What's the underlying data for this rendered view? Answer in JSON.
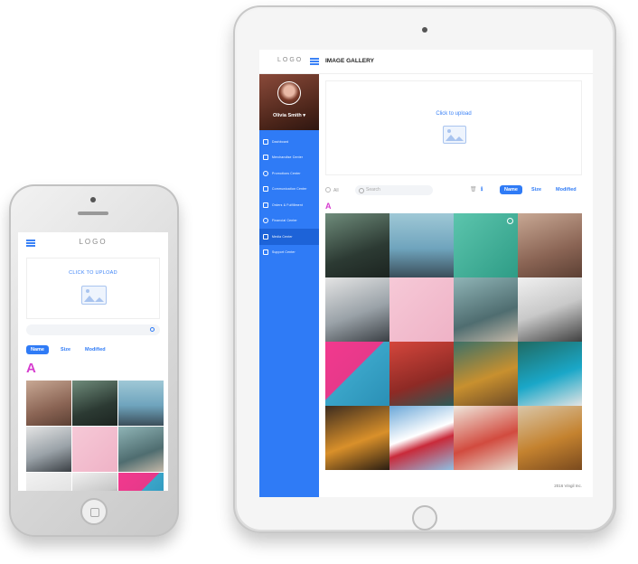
{
  "tablet": {
    "logo": "LOGO",
    "title": "IMAGE GALLERY",
    "user_name": "Olivia Smith",
    "user_caret": "▾",
    "nav": [
      {
        "label": "Dashboard",
        "icon": "grid-icon"
      },
      {
        "label": "Merchandise Center",
        "icon": "list-icon"
      },
      {
        "label": "Promotions Center",
        "icon": "megaphone-icon"
      },
      {
        "label": "Communication Center",
        "icon": "chat-icon"
      },
      {
        "label": "Orders & Fulfillment",
        "icon": "box-icon"
      },
      {
        "label": "Financial Center",
        "icon": "dollar-icon"
      },
      {
        "label": "Media Center",
        "icon": "media-icon",
        "active": true
      },
      {
        "label": "Support Center",
        "icon": "gear-icon"
      }
    ],
    "upload_label": "Click to upload",
    "filter_all": "All",
    "search_placeholder": "Search",
    "trash_icon": "🗑",
    "info_icon": "ℹ",
    "sort": [
      "Name",
      "Size",
      "Modified"
    ],
    "active_sort": "Name",
    "section_letter": "A",
    "footer": "2016 Vingil Inc."
  },
  "phone": {
    "logo": "LOGO",
    "upload_label": "CLICK TO UPLOAD",
    "sort": [
      "Name",
      "Size",
      "Modified"
    ],
    "active_sort": "Name",
    "section_letter": "A"
  },
  "colors": {
    "accent": "#2f7bf6",
    "letter": "#d63ccf",
    "sidebar": "#2f7bf6"
  },
  "gallery": [
    {
      "name": "phone-photo",
      "bg": "linear-gradient(160deg,#6f8c7b,#2c3a33 60%,#1c2420)"
    },
    {
      "name": "woman-hat",
      "bg": "linear-gradient(180deg,#9fc8d6,#6fa4bd 55%,#3b4e5a)"
    },
    {
      "name": "headphones-teal",
      "bg": "linear-gradient(135deg,#5cc5ad,#2e9c86)"
    },
    {
      "name": "pug-blanket",
      "bg": "linear-gradient(160deg,#c8a894,#8a6454 60%,#5c4034)"
    },
    {
      "name": "desk-monitor",
      "bg": "linear-gradient(160deg,#e4e4e4,#9aa2a8 55%,#3a3f44)"
    },
    {
      "name": "headphones-pink",
      "bg": "linear-gradient(135deg,#f6c9d7,#efb2c6)"
    },
    {
      "name": "pocket-watch",
      "bg": "linear-gradient(160deg,#8fb4b6,#4f6d70 60%,#c4b8a8)"
    },
    {
      "name": "camera",
      "bg": "linear-gradient(160deg,#f0f0f0,#c9c9c9 50%,#404040)"
    },
    {
      "name": "pink-fabric",
      "bg": "linear-gradient(135deg,#f2398e,#e7398a 45%,#3aa5c9 46%,#2a8fb5)"
    },
    {
      "name": "mug-hands",
      "bg": "linear-gradient(160deg,#d4463c,#8e2a25 60%,#2b5a57)"
    },
    {
      "name": "burger",
      "bg": "linear-gradient(160deg,#3c7067,#c8902f 55%,#6d4a26)"
    },
    {
      "name": "blue-car",
      "bg": "linear-gradient(160deg,#1f6a62,#1aa7c8 55%,#e4e4e4)"
    },
    {
      "name": "orange-slices",
      "bg": "linear-gradient(160deg,#3d2c1f,#d9902a 55%,#2a1d12)"
    },
    {
      "name": "strawberries",
      "bg": "linear-gradient(160deg,#6aa7d8,#ffffff 45%,#c92a3a 60%,#8fc0e4)"
    },
    {
      "name": "alarm-clock",
      "bg": "linear-gradient(160deg,#efe7dc,#d24b3f 55%,#e6dccf)"
    },
    {
      "name": "cookies",
      "bg": "linear-gradient(160deg,#d9c6a8,#c4822f 55%,#7a4a1e)"
    }
  ],
  "phone_gallery": [
    {
      "name": "pug-blanket",
      "bg": "linear-gradient(160deg,#c8a894,#8a6454 60%,#5c4034)"
    },
    {
      "name": "phone-photo",
      "bg": "linear-gradient(160deg,#6f8c7b,#2c3a33 60%,#1c2420)"
    },
    {
      "name": "woman-hat",
      "bg": "linear-gradient(180deg,#9fc8d6,#6fa4bd 55%,#3b4e5a)"
    },
    {
      "name": "desk-monitor",
      "bg": "linear-gradient(160deg,#e4e4e4,#9aa2a8 55%,#3a3f44)"
    },
    {
      "name": "headphones-pink",
      "bg": "linear-gradient(135deg,#f6c9d7,#efb2c6)"
    },
    {
      "name": "pocket-watch",
      "bg": "linear-gradient(160deg,#8fb4b6,#4f6d70 60%,#c4b8a8)"
    },
    {
      "name": "headphones-white",
      "bg": "linear-gradient(160deg,#f2f2f2,#d8d8d8)"
    },
    {
      "name": "camera",
      "bg": "linear-gradient(160deg,#f0f0f0,#c9c9c9 50%,#404040)"
    },
    {
      "name": "pink-fabric",
      "bg": "linear-gradient(135deg,#f2398e,#e7398a 45%,#3aa5c9 46%,#2a8fb5)"
    }
  ]
}
